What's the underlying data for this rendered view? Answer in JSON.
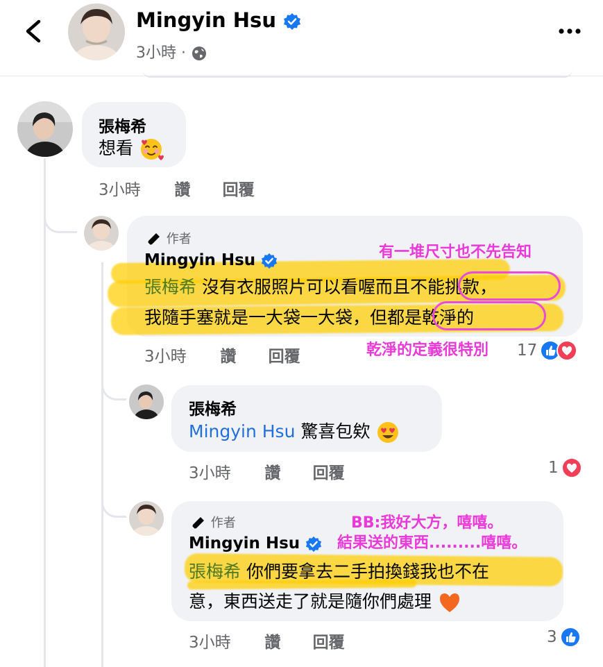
{
  "header": {
    "name": "Mingyin Hsu",
    "meta": "3小時 · "
  },
  "comments": [
    {
      "name": "張梅希",
      "text": "想看",
      "time": "3小時",
      "like": "讚",
      "reply": "回覆"
    },
    {
      "author_badge": "作者",
      "name": "Mingyin Hsu",
      "mention": "張梅希",
      "line1": " 沒有衣服照片可以看喔而且不能挑款，",
      "line2": "我隨手塞就是一大袋一大袋，但都是乾淨的",
      "time": "3小時",
      "like": "讚",
      "reply": "回覆",
      "reaction_count": "17"
    },
    {
      "name": "張梅希",
      "mention": "Mingyin Hsu",
      "text": " 驚喜包欸",
      "time": "3小時",
      "like": "讚",
      "reply": "回覆",
      "reaction_count": "1"
    },
    {
      "author_badge": "作者",
      "name": "Mingyin Hsu",
      "mention": "張梅希",
      "line1": " 你們要拿去二手拍換錢我也不在",
      "line2": "意，東西送走了就是隨你們處理",
      "time": "3小時",
      "like": "讚",
      "reply": "回覆",
      "reaction_count": "3"
    }
  ],
  "annotations": {
    "note1": "有一堆尺寸也不先告知",
    "note2": "乾淨的定義很特別",
    "note3": "BB:我好大方，嘻嘻。",
    "note4": "結果送的東西.........嘻嘻。"
  },
  "colors": {
    "facebook_blue": "#1877f2",
    "love_red": "#f33e58",
    "annotation_pink": "#e93ad9",
    "highlight_yellow": "#ffcd00"
  }
}
